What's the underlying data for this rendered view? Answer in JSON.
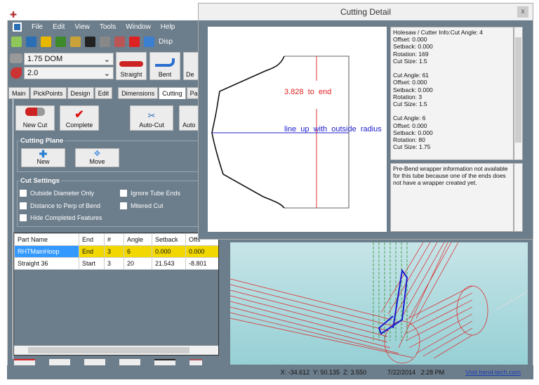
{
  "menu": [
    "File",
    "Edit",
    "View",
    "Tools",
    "Window",
    "Help"
  ],
  "toolbar": {
    "display_label": "Disp"
  },
  "material_combo": "1.75 DOM",
  "radius_combo": "2.0",
  "shape_buttons": [
    "Straight",
    "Bent",
    "De"
  ],
  "tabs": [
    "Main",
    "PickPoints",
    "Design",
    "Edit",
    "Dimensions",
    "Cutting",
    "Parts"
  ],
  "active_tab": "Cutting",
  "cut_buttons": [
    "New Cut",
    "Complete",
    "Auto-Cut",
    "Auto"
  ],
  "cutting_plane": {
    "title": "Cutting Plane",
    "buttons": [
      "New",
      "Move"
    ]
  },
  "cut_settings": {
    "title": "Cut Settings",
    "options": [
      "Outside Diameter Only",
      "Distance to Perp of Bend",
      "Hide Completed Features",
      "Ignore Tube Ends",
      "Mitered Cut"
    ]
  },
  "table": {
    "columns": [
      "Part Name",
      "End",
      "#",
      "Angle",
      "Setback",
      "Offs"
    ],
    "rows": [
      [
        "RHTMainHoop",
        "End",
        "3",
        "6",
        "0.000",
        "0.000"
      ],
      [
        "Straight 36",
        "Start",
        "3",
        "20",
        "21.543",
        "-8.801"
      ]
    ]
  },
  "dialog": {
    "title": "Cutting Detail",
    "close": "x",
    "drawing": {
      "end_label": "3.828  to  end",
      "radius_label": "line  up  with  outside  radius"
    },
    "info_text": "Holesaw / Cutter Info:Cut Angle: 4\nOffset: 0.000\nSetback: 0.000\nRotation: 169\nCut Size: 1.5\n\nCut Angle: 61\nOffset: 0.000\nSetback: 0.000\nRotation: 3\nCut Size: 1.5\n\nCut Angle: 6\nOffset: 0.000\nSetback: 0.000\nRotation: 80\nCut Size: 1.75",
    "wrapper_text": "Pre-Bend wrapper information not available for this tube because one of the ends does not have a wrapper created yet."
  },
  "status": {
    "coords": "X: -34.612  Y: 50.135  Z: 3.550",
    "datetime": "7/22/2014   2:28 PM",
    "link": "Visit bend-tech.com"
  },
  "colors": {
    "panel": "#6c7d8b",
    "highlight_row": "#f2d800",
    "selected_cell": "#3399ff",
    "view_bg": "#a9d9dd"
  }
}
